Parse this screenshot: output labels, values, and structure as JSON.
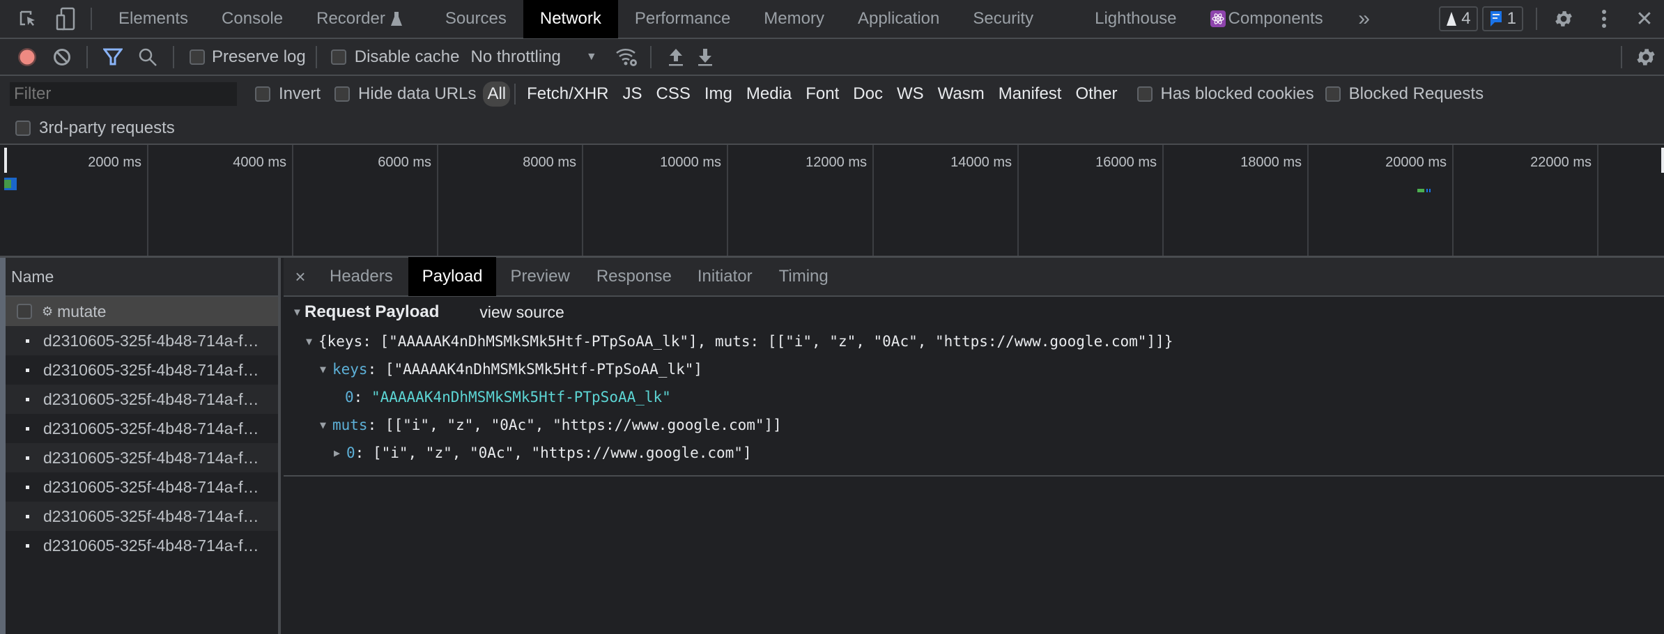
{
  "tabbar": {
    "tabs": [
      {
        "label": "Elements"
      },
      {
        "label": "Console"
      },
      {
        "label": "Recorder"
      },
      {
        "label": "Sources"
      },
      {
        "label": "Network",
        "active": true
      },
      {
        "label": "Performance"
      },
      {
        "label": "Memory"
      },
      {
        "label": "Application"
      },
      {
        "label": "Security"
      },
      {
        "label": "Lighthouse"
      },
      {
        "label": "Components"
      }
    ],
    "more_glyph": "»",
    "warnings_count": "4",
    "messages_count": "1",
    "close_glyph": "✕"
  },
  "toolbar": {
    "preserve_log_label": "Preserve log",
    "disable_cache_label": "Disable cache",
    "throttling_value": "No throttling"
  },
  "filterbar": {
    "filter_placeholder": "Filter",
    "invert_label": "Invert",
    "hide_data_urls_label": "Hide data URLs",
    "types": [
      "All",
      "Fetch/XHR",
      "JS",
      "CSS",
      "Img",
      "Media",
      "Font",
      "Doc",
      "WS",
      "Wasm",
      "Manifest",
      "Other"
    ],
    "active_type": "All",
    "has_blocked_cookies_label": "Has blocked cookies",
    "blocked_requests_label": "Blocked Requests",
    "third_party_label": "3rd-party requests"
  },
  "timeline": {
    "ticks": [
      "2000 ms",
      "4000 ms",
      "6000 ms",
      "8000 ms",
      "10000 ms",
      "12000 ms",
      "14000 ms",
      "16000 ms",
      "18000 ms",
      "20000 ms",
      "22000 ms"
    ],
    "colors": {
      "waiting": "#4caf50",
      "download": "#1a73e8"
    }
  },
  "requests": {
    "column_name": "Name",
    "items": [
      {
        "name": "mutate",
        "selected": true
      },
      {
        "name": "d2310605-325f-4b48-714a-f…"
      },
      {
        "name": "d2310605-325f-4b48-714a-f…"
      },
      {
        "name": "d2310605-325f-4b48-714a-f…"
      },
      {
        "name": "d2310605-325f-4b48-714a-f…"
      },
      {
        "name": "d2310605-325f-4b48-714a-f…"
      },
      {
        "name": "d2310605-325f-4b48-714a-f…"
      },
      {
        "name": "d2310605-325f-4b48-714a-f…"
      },
      {
        "name": "d2310605-325f-4b48-714a-f…"
      }
    ]
  },
  "details": {
    "close_glyph": "×",
    "tabs": [
      "Headers",
      "Payload",
      "Preview",
      "Response",
      "Initiator",
      "Timing"
    ],
    "active_tab": "Payload",
    "section_title": "Request Payload",
    "view_source_label": "view source",
    "payload": {
      "root_summary": "{keys: [\"AAAAAK4nDhMSMkSMk5Htf-PTpSoAA_lk\"], muts: [[\"i\", \"z\", \"0Ac\", \"https://www.google.com\"]]}",
      "keys_key": "keys",
      "keys_summary": ": [\"AAAAAK4nDhMSMkSMk5Htf-PTpSoAA_lk\"]",
      "keys_0_key": "0",
      "keys_0_value": "\"AAAAAK4nDhMSMkSMk5Htf-PTpSoAA_lk\"",
      "muts_key": "muts",
      "muts_summary": ": [[\"i\", \"z\", \"0Ac\", \"https://www.google.com\"]]",
      "muts_0_key": "0",
      "muts_0_summary": ": [\"i\", \"z\", \"0Ac\", \"https://www.google.com\"]"
    }
  }
}
